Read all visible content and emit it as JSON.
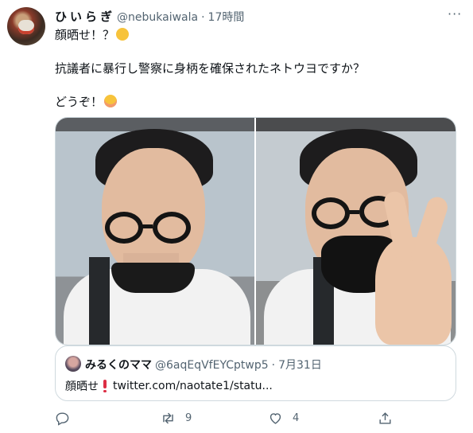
{
  "tweet": {
    "author_name": "ひいらぎ",
    "handle": "@nebukaiwala",
    "separator": "·",
    "time": "17時間",
    "lines": [
      "顔晒せ！？",
      "抗議者に暴行し警察に身柄を確保されたネトウヨですか？",
      "どうぞ！"
    ],
    "emojis": [
      "thinking-face",
      "smiling-face"
    ]
  },
  "media": {
    "photos": [
      "left-photo",
      "right-photo"
    ]
  },
  "quoted_tweet": {
    "author_name": "みるくのママ",
    "handle": "@6aqEqVfEYCptwp5",
    "separator": "·",
    "date": "7月31日",
    "text_prefix": "顔晒せ",
    "link": "twitter.com/naotate1/statu..."
  },
  "actions": {
    "reply_count": "",
    "retweet_count": "9",
    "like_count": "4"
  },
  "colors": {
    "text": "#0f1419",
    "secondary": "#536471",
    "border": "#cfd9de",
    "exclamation": "#dd2e44"
  }
}
